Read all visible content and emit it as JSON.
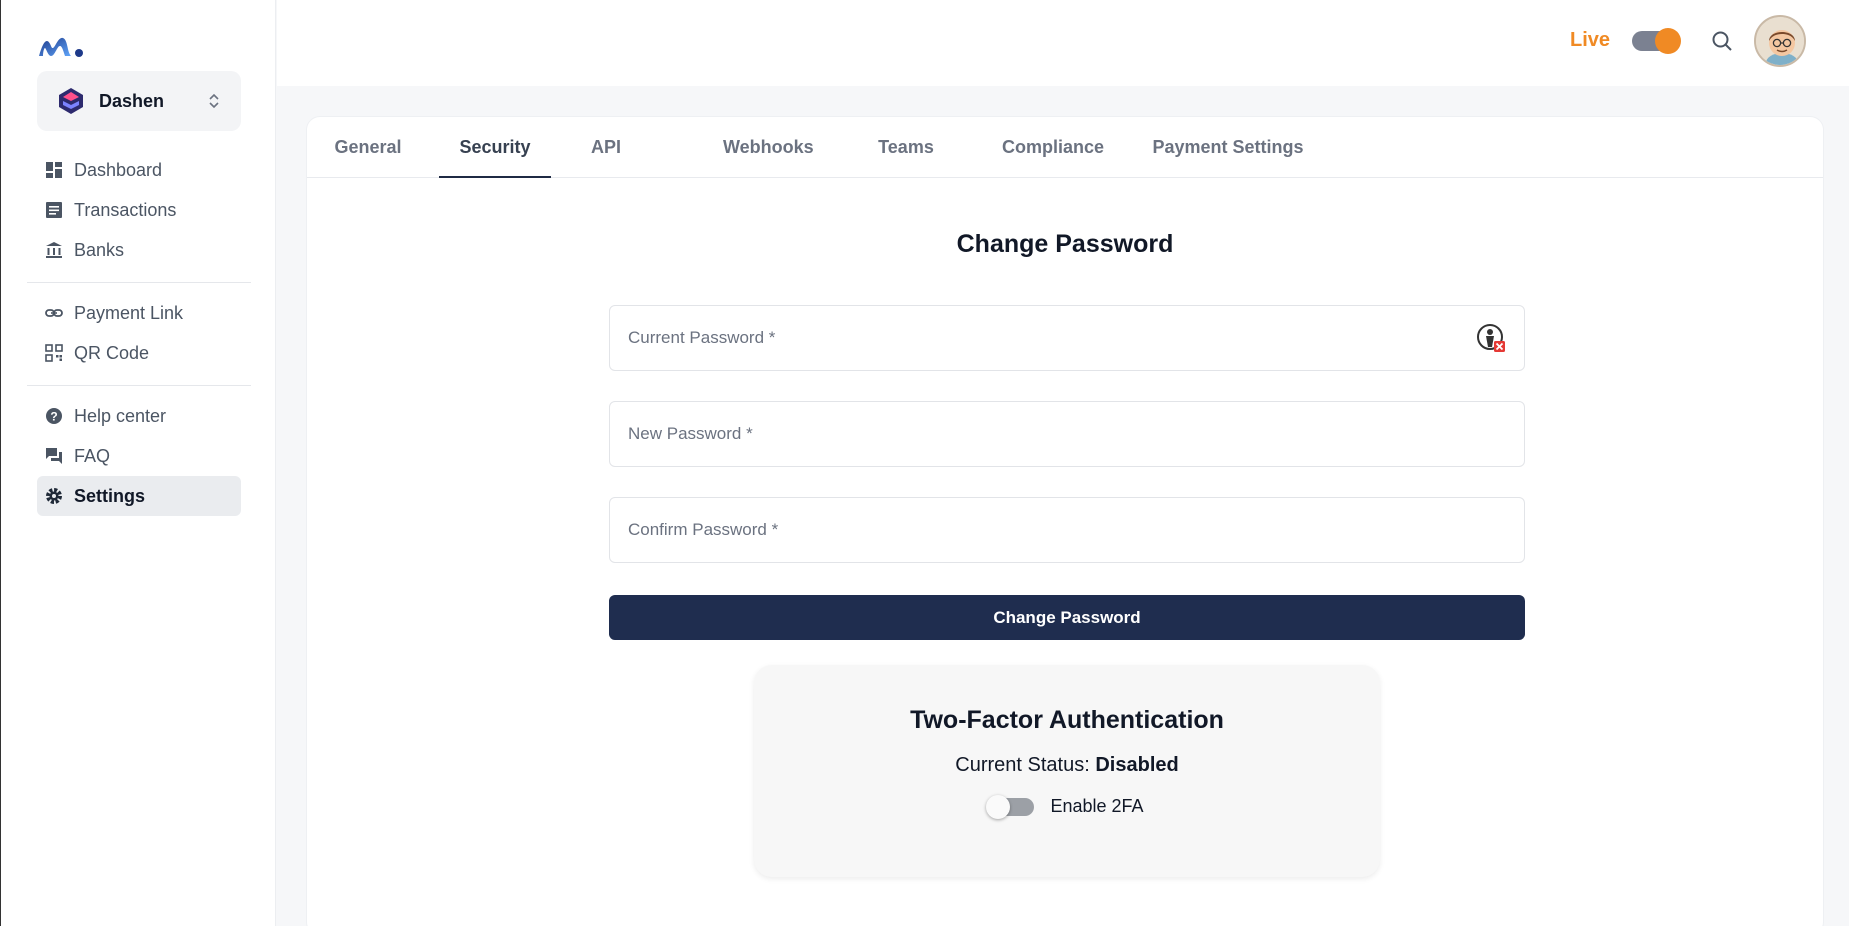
{
  "sidebar": {
    "org": {
      "name": "Dashen"
    },
    "groups": [
      [
        {
          "label": "Dashboard",
          "icon": "dashboard-icon"
        },
        {
          "label": "Transactions",
          "icon": "list-icon"
        },
        {
          "label": "Banks",
          "icon": "bank-icon"
        }
      ],
      [
        {
          "label": "Payment Link",
          "icon": "link-icon"
        },
        {
          "label": "QR Code",
          "icon": "qr-code-icon"
        }
      ],
      [
        {
          "label": "Help center",
          "icon": "help-icon"
        },
        {
          "label": "FAQ",
          "icon": "chat-icon"
        },
        {
          "label": "Settings",
          "icon": "gear-icon",
          "active": true
        }
      ]
    ]
  },
  "header": {
    "live_label": "Live",
    "live_enabled": true
  },
  "tabs": [
    {
      "label": "General"
    },
    {
      "label": "Security",
      "active": true
    },
    {
      "label": "API"
    },
    {
      "label": "Webhooks"
    },
    {
      "label": "Teams"
    },
    {
      "label": "Compliance"
    },
    {
      "label": "Payment Settings"
    }
  ],
  "password_form": {
    "title": "Change Password",
    "current_placeholder": "Current Password *",
    "new_placeholder": "New Password *",
    "confirm_placeholder": "Confirm Password *",
    "submit_label": "Change Password"
  },
  "two_factor": {
    "title": "Two-Factor Authentication",
    "status_prefix": "Current Status:",
    "status_value": "Disabled",
    "toggle_label": "Enable 2FA",
    "enabled": false
  },
  "colors": {
    "accent_orange": "#f08a24",
    "primary_navy": "#1f2d4f"
  }
}
